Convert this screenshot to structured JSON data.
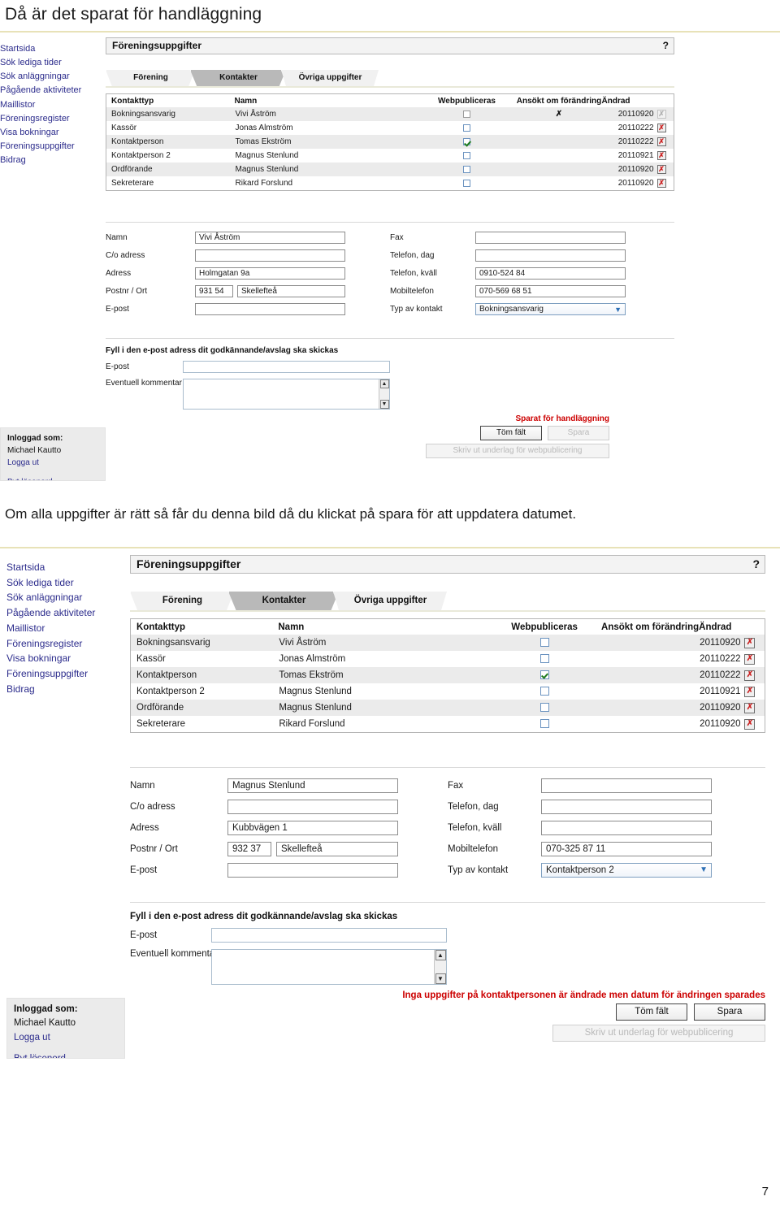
{
  "document": {
    "heading": "Då är det sparat för handläggning",
    "narrative": "Om alla uppgifter är rätt så får du denna bild då du klickat på spara för att uppdatera datumet.",
    "page_number": "7"
  },
  "sidebar": {
    "items": [
      {
        "label": "Startsida"
      },
      {
        "label": "Sök lediga tider"
      },
      {
        "label": "Sök anläggningar"
      },
      {
        "label": "Pågående aktiviteter"
      },
      {
        "label": "Maillistor"
      },
      {
        "label": "Föreningsregister"
      },
      {
        "label": "Visa bokningar"
      },
      {
        "label": "Föreningsuppgifter"
      },
      {
        "label": "Bidrag"
      }
    ],
    "login": {
      "label": "Inloggad som:",
      "user": "Michael Kautto",
      "logout": "Logga ut",
      "change_password": "Byt lösenord"
    }
  },
  "panel": {
    "title": "Föreningsuppgifter",
    "help_icon": "?",
    "tabs": [
      {
        "label": "Förening",
        "active": false
      },
      {
        "label": "Kontakter",
        "active": true
      },
      {
        "label": "Övriga uppgifter",
        "active": false
      }
    ]
  },
  "table": {
    "columns": [
      "Kontakttyp",
      "Namn",
      "Webpubliceras",
      "Ansökt om förändring",
      "Ändrad"
    ],
    "delete_icon": "✗"
  },
  "screenshot1": {
    "rows": [
      {
        "type": "Bokningsansvarig",
        "name": "Vivi Åström",
        "webpublish": false,
        "applied": "✗",
        "changed": "20110920",
        "delete_disabled": true
      },
      {
        "type": "Kassör",
        "name": "Jonas Almström",
        "webpublish": false,
        "applied": "",
        "changed": "20110222",
        "delete_disabled": false
      },
      {
        "type": "Kontaktperson",
        "name": "Tomas Ekström",
        "webpublish": true,
        "applied": "",
        "changed": "20110222",
        "delete_disabled": false
      },
      {
        "type": "Kontaktperson 2",
        "name": "Magnus Stenlund",
        "webpublish": false,
        "applied": "",
        "changed": "20110921",
        "delete_disabled": false
      },
      {
        "type": "Ordförande",
        "name": "Magnus Stenlund",
        "webpublish": false,
        "applied": "",
        "changed": "20110920",
        "delete_disabled": false
      },
      {
        "type": "Sekreterare",
        "name": "Rikard Forslund",
        "webpublish": false,
        "applied": "",
        "changed": "20110920",
        "delete_disabled": false
      }
    ],
    "form": {
      "left": [
        {
          "label": "Namn",
          "value": "Vivi Åström"
        },
        {
          "label": "C/o adress",
          "value": ""
        },
        {
          "label": "Adress",
          "value": "Holmgatan 9a"
        },
        {
          "label": "Postnr / Ort",
          "value": "931 54",
          "value2": "Skellefteå"
        },
        {
          "label": "E-post",
          "value": ""
        }
      ],
      "right": [
        {
          "label": "Fax",
          "value": ""
        },
        {
          "label": "Telefon, dag",
          "value": ""
        },
        {
          "label": "Telefon, kväll",
          "value": "0910-524 84"
        },
        {
          "label": "Mobiltelefon",
          "value": "070-569 68 51"
        },
        {
          "label": "Typ av kontakt",
          "value": "Bokningsansvarig",
          "select": true
        }
      ]
    },
    "email_block": {
      "heading": "Fyll i den e-post adress dit godkännande/avslag ska skickas",
      "email_label": "E-post",
      "email_value": "",
      "comment_label": "Eventuell kommentar",
      "comment_value": ""
    },
    "status_message": "Sparat för handläggning",
    "buttons": {
      "clear": "Töm fält",
      "clear_disabled": false,
      "save": "Spara",
      "save_disabled": true,
      "print": "Skriv ut underlag för  webpublicering",
      "print_disabled": true
    }
  },
  "screenshot2": {
    "rows": [
      {
        "type": "Bokningsansvarig",
        "name": "Vivi Åström",
        "webpublish": false,
        "applied": "",
        "changed": "20110920",
        "delete_disabled": false
      },
      {
        "type": "Kassör",
        "name": "Jonas Almström",
        "webpublish": false,
        "applied": "",
        "changed": "20110222",
        "delete_disabled": false
      },
      {
        "type": "Kontaktperson",
        "name": "Tomas Ekström",
        "webpublish": true,
        "applied": "",
        "changed": "20110222",
        "delete_disabled": false
      },
      {
        "type": "Kontaktperson 2",
        "name": "Magnus Stenlund",
        "webpublish": false,
        "applied": "",
        "changed": "20110921",
        "delete_disabled": false
      },
      {
        "type": "Ordförande",
        "name": "Magnus Stenlund",
        "webpublish": false,
        "applied": "",
        "changed": "20110920",
        "delete_disabled": false
      },
      {
        "type": "Sekreterare",
        "name": "Rikard Forslund",
        "webpublish": false,
        "applied": "",
        "changed": "20110920",
        "delete_disabled": false
      }
    ],
    "form": {
      "left": [
        {
          "label": "Namn",
          "value": "Magnus Stenlund"
        },
        {
          "label": "C/o adress",
          "value": ""
        },
        {
          "label": "Adress",
          "value": "Kubbvägen 1"
        },
        {
          "label": "Postnr / Ort",
          "value": "932 37",
          "value2": "Skellefteå"
        },
        {
          "label": "E-post",
          "value": ""
        }
      ],
      "right": [
        {
          "label": "Fax",
          "value": ""
        },
        {
          "label": "Telefon, dag",
          "value": ""
        },
        {
          "label": "Telefon, kväll",
          "value": ""
        },
        {
          "label": "Mobiltelefon",
          "value": "070-325 87 11"
        },
        {
          "label": "Typ av kontakt",
          "value": "Kontaktperson 2",
          "select": true
        }
      ]
    },
    "email_block": {
      "heading": "Fyll i den e-post adress dit godkännande/avslag ska skickas",
      "email_label": "E-post",
      "email_value": "",
      "comment_label": "Eventuell kommentar",
      "comment_value": ""
    },
    "status_message": "Inga uppgifter på kontaktpersonen är ändrade men datum för ändringen sparades",
    "buttons": {
      "clear": "Töm fält",
      "clear_disabled": false,
      "save": "Spara",
      "save_disabled": false,
      "print": "Skriv ut underlag för  webpublicering",
      "print_disabled": true
    }
  },
  "colors": {
    "link": "#2c2c8c",
    "alert_red": "#cc0000",
    "row_alt": "#ebebeb",
    "tab_active": "#b9b9b9",
    "rule": "#e8e2b8"
  }
}
